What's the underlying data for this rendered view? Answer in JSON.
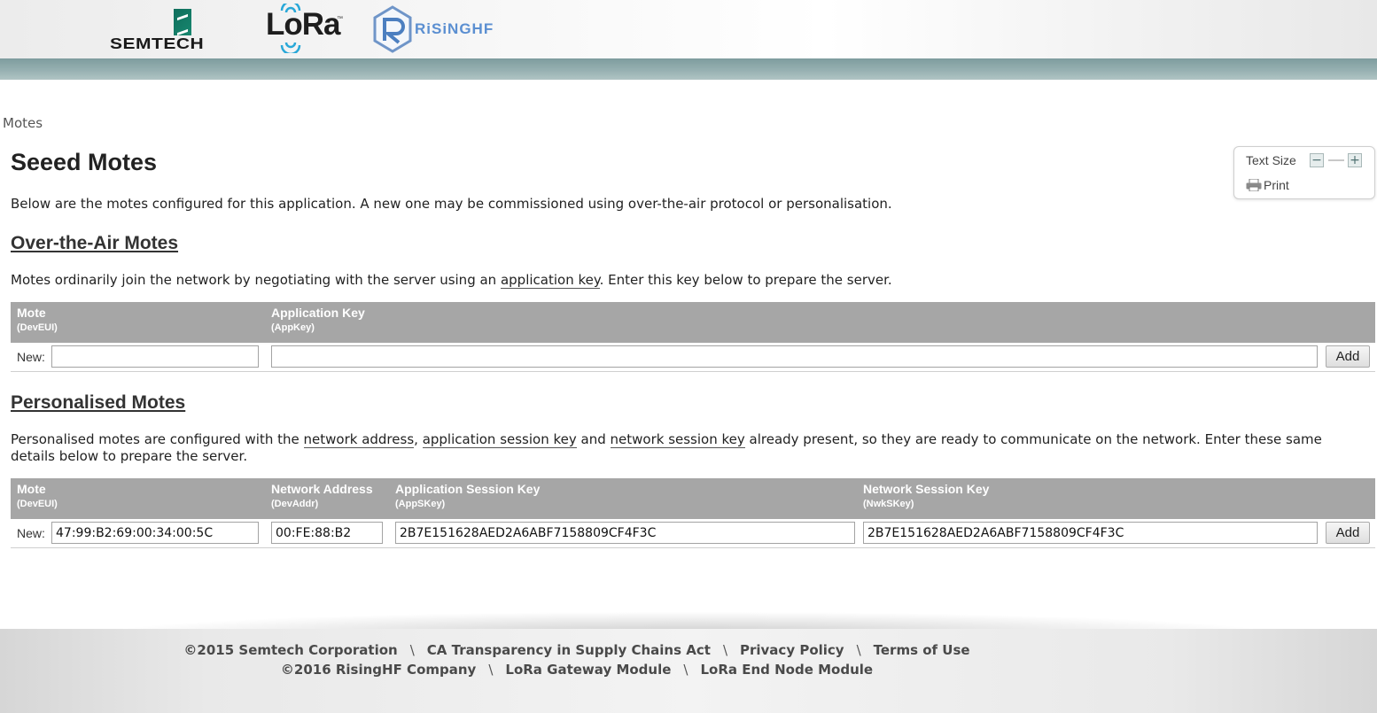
{
  "header": {
    "logos": {
      "semtech": "SEMTECH",
      "lora": "LoRa",
      "lora_tm": "™",
      "risinghf": "RiSiNGHF"
    },
    "bar_color": "#8aa6a7"
  },
  "breadcrumb": "Motes",
  "page_title": "Seeed Motes",
  "text_size": {
    "label": "Text Size",
    "decrease": "−",
    "increase": "+",
    "print": "Print"
  },
  "intro": "Below are the motes configured for this application. A new one may be commissioned using over-the-air protocol or personalisation.",
  "ota": {
    "heading": "Over-the-Air Motes",
    "desc_before": "Motes ordinarily join the network by negotiating with the server using an ",
    "desc_term": "application key",
    "desc_after": ". Enter this key below to prepare the server.",
    "columns": [
      {
        "label": "Mote",
        "sub": "(DevEUI)"
      },
      {
        "label": "Application Key",
        "sub": "(AppKey)"
      }
    ],
    "row": {
      "new_label": "New:",
      "dev_eui": "",
      "app_key": "",
      "add_label": "Add"
    }
  },
  "personalised": {
    "heading": "Personalised Motes",
    "desc_1": "Personalised motes are configured with the ",
    "term_1": "network address",
    "desc_2": ", ",
    "term_2": "application session key",
    "desc_3": " and ",
    "term_3": "network session key",
    "desc_4": " already present, so they are ready to communicate on the network. Enter these same details below to prepare the server.",
    "columns": [
      {
        "label": "Mote",
        "sub": "(DevEUI)"
      },
      {
        "label": "Network Address",
        "sub": "(DevAddr)"
      },
      {
        "label": "Application Session Key",
        "sub": "(AppSKey)"
      },
      {
        "label": "Network Session Key",
        "sub": "(NwkSKey)"
      }
    ],
    "row": {
      "new_label": "New:",
      "dev_eui": "47:99:B2:69:00:34:00:5C",
      "dev_addr": "00:FE:88:B2",
      "app_skey": "2B7E151628AED2A6ABF7158809CF4F3C",
      "nwk_skey": "2B7E151628AED2A6ABF7158809CF4F3C",
      "add_label": "Add"
    }
  },
  "footer": {
    "line1": [
      "©2015 Semtech Corporation",
      "CA Transparency in Supply Chains Act",
      "Privacy Policy",
      "Terms of Use"
    ],
    "line2": [
      "©2016 RisingHF Company",
      "LoRa Gateway Module",
      "LoRa End Node Module"
    ],
    "separator": "\\"
  }
}
